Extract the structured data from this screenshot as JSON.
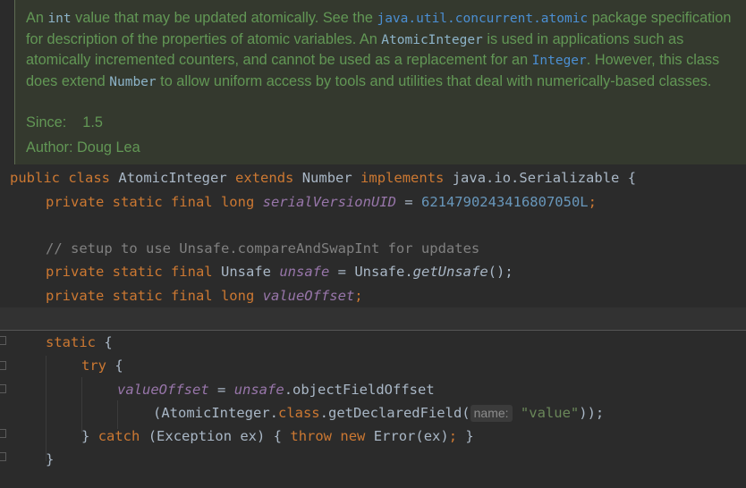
{
  "javadoc": {
    "p1": "An ",
    "code_int": "int",
    "p2": " value that may be updated atomically. See the ",
    "link_pkg": "java.util.concurrent.atomic",
    "p3": " package specification for description of the properties of atomic variables. An ",
    "code_ai": "AtomicInteger",
    "p4": " is used in applications such as atomically incremented counters, and cannot be used as a replacement for an ",
    "link_integer": "Integer",
    "p5": ". However, this class does extend ",
    "code_number": "Number",
    "p6": " to allow uniform access by tools and utilities that deal with numerically-based classes.",
    "since_label": "Since:",
    "since_value": "1.5",
    "author_label": "Author:",
    "author_value": "Doug Lea"
  },
  "code": {
    "l1": {
      "kw1": "public",
      "kw2": "class",
      "name": "AtomicInteger",
      "kw3": "extends",
      "sup": "Number",
      "kw4": "implements",
      "iface": "java.io.Serializable",
      "brace": "{"
    },
    "l2": {
      "kw": "private static final long",
      "field": "serialVersionUID",
      "eq": "=",
      "num": "6214790243416807050L",
      "semi": ";"
    },
    "l3": {
      "comment": "// setup to use Unsafe.compareAndSwapInt for updates"
    },
    "l4": {
      "kw": "private static final",
      "type": "Unsafe",
      "field": "unsafe",
      "eq": "= Unsafe.",
      "call": "getUnsafe",
      "end": "();"
    },
    "l5": {
      "kw": "private static final long",
      "field": "valueOffset",
      "semi": ";"
    },
    "l6": {
      "kw": "static",
      "brace": "{"
    },
    "l7": {
      "kw": "try",
      "brace": "{"
    },
    "l8": {
      "field1": "valueOffset",
      "eq": "=",
      "field2": "unsafe",
      "rest": ".objectFieldOffset"
    },
    "l9": {
      "a": "(AtomicInteger.",
      "kw": "class",
      "b": ".getDeclaredField(",
      "hint": "name:",
      "str": "\"value\"",
      "c": "));"
    },
    "l10": {
      "a": "}",
      "kw1": "catch",
      "b": "(Exception ex) {",
      "kw2": "throw",
      "kw3": "new",
      "c": "Error(ex)",
      "semi": ";",
      "d": "}"
    },
    "l11": {
      "brace": "}"
    }
  },
  "colors": {
    "background": "#2b2b2b",
    "javadoc_background": "#34392e",
    "javadoc_text": "#629755",
    "keyword": "#cc7832",
    "number": "#6897bb",
    "string": "#6a8759",
    "field": "#9876aa",
    "comment": "#808080",
    "default_text": "#a9b7c6"
  }
}
